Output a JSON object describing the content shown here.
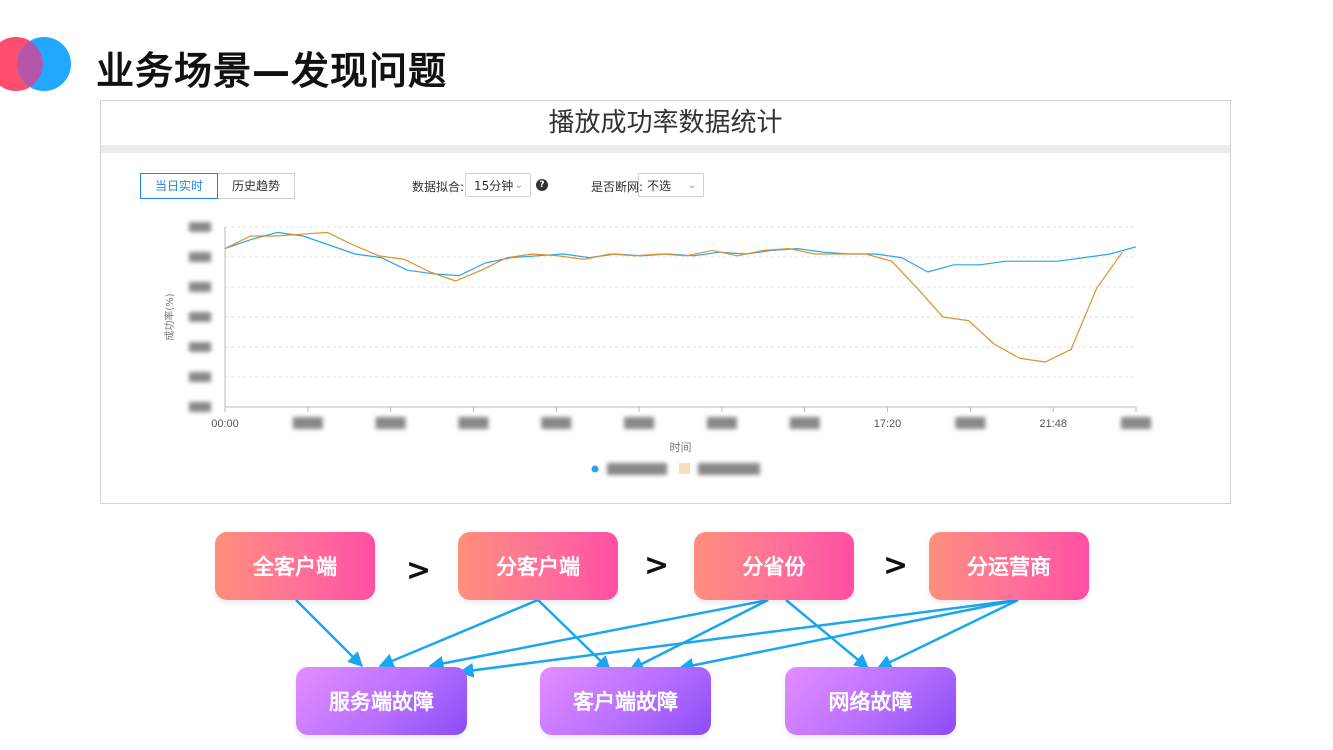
{
  "slide": {
    "title": "业务场景—发现问题"
  },
  "colors": {
    "logo_left": "#ff4d6d",
    "logo_right": "#21a8ff",
    "series_blue": "#2aa5e8",
    "series_orange": "#e0902a",
    "arrow": "#1aa7f0"
  },
  "panel": {
    "title": "播放成功率数据统计",
    "tabs": [
      {
        "label": "当日实时",
        "active": true
      },
      {
        "label": "历史趋势",
        "active": false
      }
    ],
    "fit_label": "数据拟合:",
    "fit_value": "15分钟",
    "disconnect_label": "是否断网:",
    "disconnect_value": "不选"
  },
  "chart_data": {
    "type": "line",
    "ylabel": "成功率(%)",
    "xlabel": "时间",
    "x_ticks": [
      "00:00",
      "",
      "",
      "",
      "",
      "",
      "",
      "",
      "17:20",
      "",
      "21:48",
      ""
    ],
    "series": [
      {
        "color": "#2aa5e8",
        "values": [
          88.8,
          89.3,
          89.7,
          89.5,
          89.0,
          88.5,
          88.3,
          87.6,
          87.4,
          87.3,
          88.0,
          88.3,
          88.4,
          88.5,
          88.3,
          88.5,
          88.4,
          88.5,
          88.4,
          88.6,
          88.5,
          88.7,
          88.8,
          88.6,
          88.5,
          88.5,
          88.3,
          87.5,
          87.9,
          87.9,
          88.1,
          88.1,
          88.1,
          88.3,
          88.5,
          88.9
        ]
      },
      {
        "color": "#e0902a",
        "values": [
          88.8,
          89.5,
          89.5,
          89.6,
          89.7,
          89.0,
          88.4,
          88.2,
          87.5,
          87.0,
          87.6,
          88.3,
          88.5,
          88.4,
          88.2,
          88.5,
          88.4,
          88.5,
          88.4,
          88.7,
          88.4,
          88.7,
          88.8,
          88.5,
          88.5,
          88.5,
          88.1,
          86.6,
          85.0,
          84.8,
          83.5,
          82.7,
          82.5,
          83.2,
          86.6,
          88.6
        ]
      }
    ],
    "ylim": [
      80,
      90
    ],
    "grid": true
  },
  "flow": {
    "top": [
      "全客户端",
      "分客户端",
      "分省份",
      "分运营商"
    ],
    "separator": ">",
    "bottom": [
      "服务端故障",
      "客户端故障",
      "网络故障"
    ]
  }
}
